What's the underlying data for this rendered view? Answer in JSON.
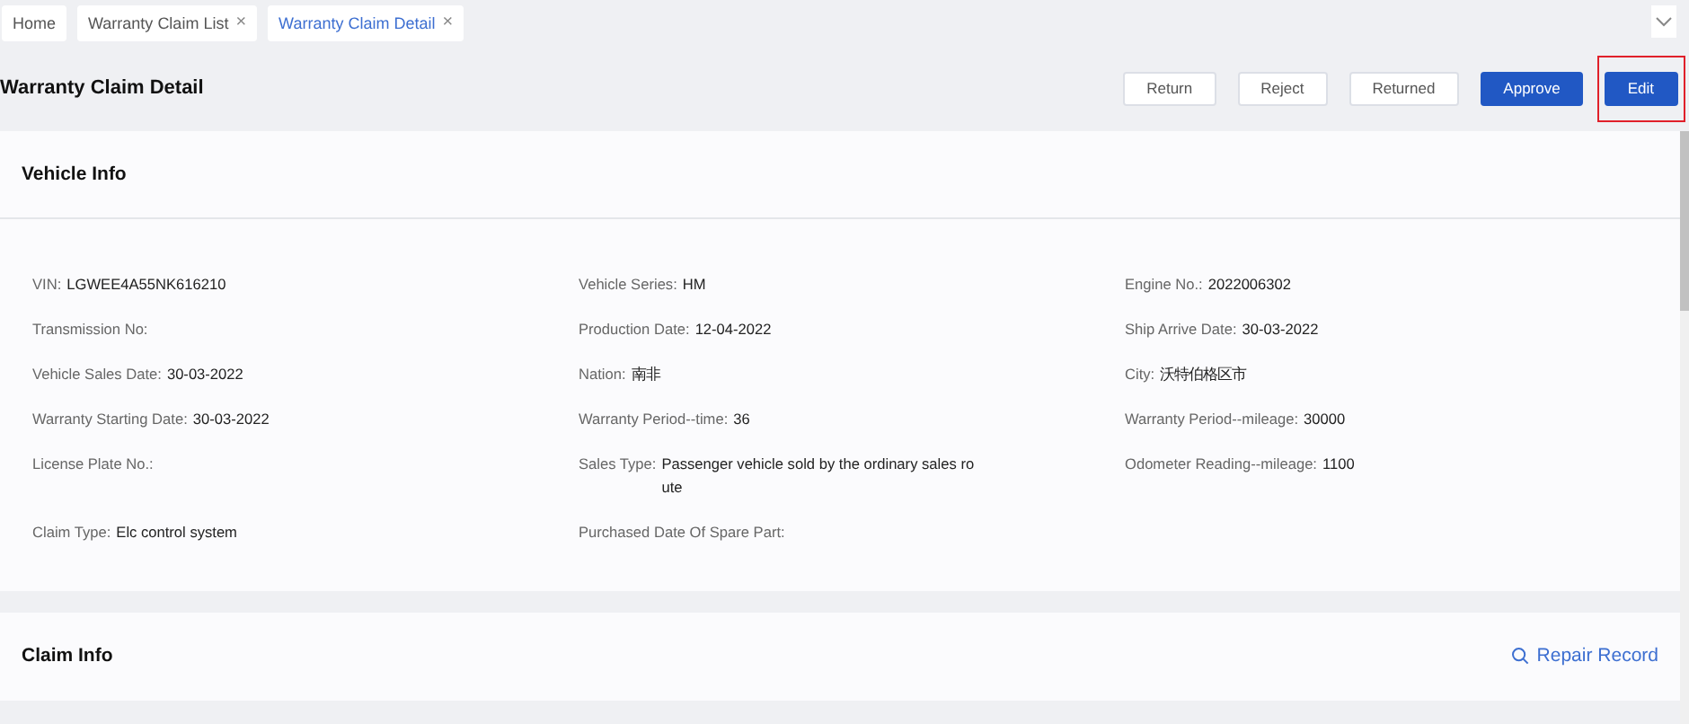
{
  "tabs": [
    {
      "label": "Home",
      "selected": false
    },
    {
      "label": "Warranty Claim List",
      "close": "×",
      "selected": false
    },
    {
      "label": "Warranty Claim Detail",
      "close": "×",
      "selected": true
    }
  ],
  "page_title": "Warranty Claim Detail",
  "actions": [
    {
      "label": "Return",
      "kind": "default",
      "highlighted": false
    },
    {
      "label": "Reject",
      "kind": "default",
      "highlighted": false
    },
    {
      "label": "Returned",
      "kind": "default",
      "highlighted": false
    },
    {
      "label": "Approve",
      "kind": "primary",
      "highlighted": false
    },
    {
      "label": "Edit",
      "kind": "primary",
      "highlighted": true
    }
  ],
  "vehicle_info": {
    "title": "Vehicle Info",
    "fields": [
      {
        "label": "VIN:",
        "value": "LGWEE4A55NK616210"
      },
      {
        "label": "Vehicle Series:",
        "value": "HM"
      },
      {
        "label": "Engine No.:",
        "value": "2022006302"
      },
      {
        "label": "Transmission No:"
      },
      {
        "label": "Production Date:",
        "value": "12-04-2022"
      },
      {
        "label": "Ship Arrive Date:",
        "value": "30-03-2022"
      },
      {
        "label": "Vehicle Sales Date:",
        "value": "30-03-2022"
      },
      {
        "label": "Nation:",
        "value": "南非"
      },
      {
        "label": "City:",
        "value": "沃特伯格区市"
      },
      {
        "label": "Warranty Starting Date:",
        "value": "30-03-2022"
      },
      {
        "label": "Warranty Period--time:",
        "value": "36"
      },
      {
        "label": "Warranty Period--mileage:",
        "value": "30000"
      },
      {
        "label": "License Plate No.:"
      },
      {
        "label": "Sales Type:",
        "value": "Passenger vehicle sold by the ordinary sales route"
      },
      {
        "label": "Odometer Reading--mileage:",
        "value": "1100"
      },
      {
        "label": "Claim Type:",
        "value": "Elc control system"
      },
      {
        "label": "Purchased Date Of Spare Part:"
      }
    ]
  },
  "claim_info": {
    "title": "Claim Info",
    "link": "Repair Record"
  }
}
